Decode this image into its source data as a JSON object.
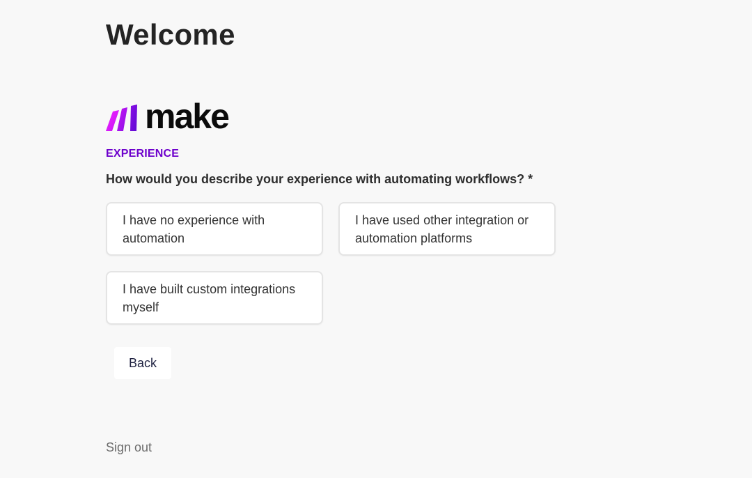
{
  "header": {
    "title": "Welcome"
  },
  "logo": {
    "wordmark": "make",
    "icon": "make-logo-icon",
    "gradient_colors": [
      "#e81cff",
      "#a010f0",
      "#6a0dd8"
    ]
  },
  "form": {
    "section_label": "EXPERIENCE",
    "question": "How would you describe your experience with automating workflows? *",
    "options": [
      {
        "label": "I have no experience with automation"
      },
      {
        "label": "I have used other integration or automation platforms"
      },
      {
        "label": "I have built custom integrations myself"
      }
    ],
    "back_label": "Back"
  },
  "footer": {
    "sign_out_label": "Sign out"
  },
  "colors": {
    "background": "#f8f8f8",
    "accent": "#6d00cc",
    "card_border": "#e4e4e4"
  }
}
